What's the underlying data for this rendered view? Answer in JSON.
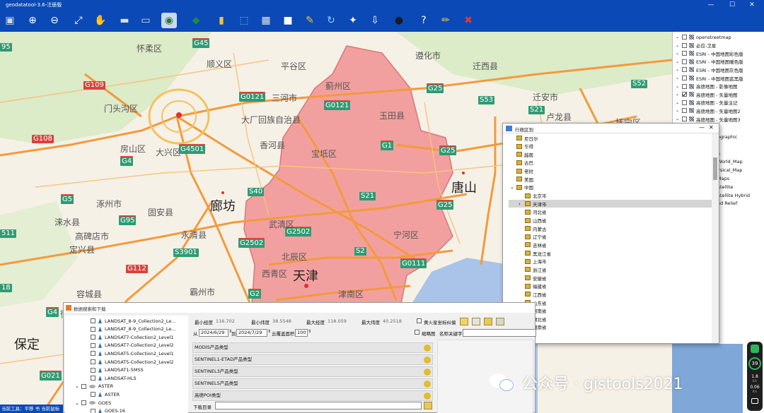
{
  "window": {
    "title": "geodatatool-3.6-注册版"
  },
  "toolbar": {
    "buttons": [
      {
        "name": "save-icon",
        "glyph": "▣",
        "color": "#cfd8ea"
      },
      {
        "name": "zoom-in-icon",
        "glyph": "⊕",
        "color": "#ffffff"
      },
      {
        "name": "zoom-out-icon",
        "glyph": "⊖",
        "color": "#ffffff"
      },
      {
        "name": "full-extent-icon",
        "glyph": "⤢",
        "color": "#ffffff"
      },
      {
        "name": "pan-hand-icon",
        "glyph": "✋",
        "color": "#ffffff"
      },
      {
        "name": "measure-icon",
        "glyph": "▬",
        "color": "#d9dde6"
      },
      {
        "name": "ruler-icon",
        "glyph": "▭",
        "color": "#d9dde6"
      },
      {
        "name": "identify-icon",
        "glyph": "◉",
        "color": "#2a7a2a"
      },
      {
        "name": "layer-icon",
        "glyph": "◆",
        "color": "#1c8b3d"
      },
      {
        "name": "attribute-icon",
        "glyph": "▮",
        "color": "#f0c33c"
      },
      {
        "name": "select-icon",
        "glyph": "⬚",
        "color": "#7ec0f0"
      },
      {
        "name": "grid-icon",
        "glyph": "▦",
        "color": "#e8e8e8"
      },
      {
        "name": "clear-icon",
        "glyph": "■",
        "color": "#ffffff"
      },
      {
        "name": "tools-icon",
        "glyph": "✎",
        "color": "#f0c33c"
      },
      {
        "name": "refresh-icon",
        "glyph": "↻",
        "color": "#8fd0ff"
      },
      {
        "name": "gps-icon",
        "glyph": "✦",
        "color": "#ffffff"
      },
      {
        "name": "download-icon",
        "glyph": "⇩",
        "color": "#ffffff"
      },
      {
        "name": "user-icon",
        "glyph": "●",
        "color": "#1b1b1b"
      },
      {
        "name": "help-icon",
        "glyph": "?",
        "color": "#ffffff"
      },
      {
        "name": "edit-icon",
        "glyph": "✏",
        "color": "#f0c33c"
      },
      {
        "name": "exit-icon",
        "glyph": "✖",
        "color": "#e23c2c"
      }
    ]
  },
  "map": {
    "roads": [
      {
        "label": "G45",
        "type": "g"
      },
      {
        "label": "G109",
        "type": "r"
      },
      {
        "label": "G0121",
        "type": "g"
      },
      {
        "label": "G0121",
        "type": "g"
      },
      {
        "label": "G25",
        "type": "g"
      },
      {
        "label": "S53",
        "type": "s"
      },
      {
        "label": "S52",
        "type": "s"
      },
      {
        "label": "S21",
        "type": "s"
      },
      {
        "label": "G108",
        "type": "r"
      },
      {
        "label": "G4501",
        "type": "g"
      },
      {
        "label": "G1",
        "type": "g"
      },
      {
        "label": "G25",
        "type": "g"
      },
      {
        "label": "G4",
        "type": "g"
      },
      {
        "label": "S40",
        "type": "s"
      },
      {
        "label": "S21",
        "type": "s"
      },
      {
        "label": "G5",
        "type": "g"
      },
      {
        "label": "G25",
        "type": "g"
      },
      {
        "label": "G95",
        "type": "g"
      },
      {
        "label": "G2502",
        "type": "g"
      },
      {
        "label": "G2502",
        "type": "g"
      },
      {
        "label": "S2",
        "type": "s"
      },
      {
        "label": "S3901",
        "type": "s"
      },
      {
        "label": "G0111",
        "type": "g"
      },
      {
        "label": "G112",
        "type": "r"
      },
      {
        "label": "G2",
        "type": "g"
      },
      {
        "label": "G4",
        "type": "g"
      },
      {
        "label": "G021",
        "type": "g"
      },
      {
        "label": "95",
        "type": "s"
      },
      {
        "label": "511",
        "type": "s"
      },
      {
        "label": "18",
        "type": "s"
      }
    ],
    "places": [
      "怀柔区",
      "顺义区",
      "平谷区",
      "遵化市",
      "迁西县",
      "蓟州区",
      "三河市",
      "门头沟区",
      "大厂回族自治县",
      "玉田县",
      "迁安市",
      "卢龙县",
      "丰润区",
      "房山区",
      "大兴区",
      "香河县",
      "宝坻区",
      "滦州市",
      "涿州市",
      "廊坊",
      "唐山",
      "涞水县",
      "固安县",
      "武清区",
      "宁河区",
      "高碑店市",
      "永清县",
      "定兴县",
      "北辰区",
      "天津",
      "西青区",
      "霸州市",
      "徐水区",
      "容城县",
      "津南区",
      "保定",
      "抚宁区"
    ],
    "cities": [
      "北京",
      "廊坊",
      "唐山",
      "天津",
      "保定"
    ]
  },
  "layers": {
    "items": [
      {
        "label": "openstreetmap",
        "checked": false
      },
      {
        "label": "必应-卫星",
        "checked": false
      },
      {
        "label": "ESRI - 中国地图彩色版",
        "checked": false
      },
      {
        "label": "ESRI - 中国地图暖色版",
        "checked": false
      },
      {
        "label": "ESRI - 中国地图灰色版",
        "checked": false
      },
      {
        "label": "ESRI - 中国地图蓝黑版",
        "checked": false
      },
      {
        "label": "高德地图 - 影像地图",
        "checked": false
      },
      {
        "label": "高德地图 - 矢量地图",
        "checked": true
      },
      {
        "label": "高德地图 - 矢量注记",
        "checked": false
      },
      {
        "label": "高德地图 - 矢量地图2",
        "checked": false
      },
      {
        "label": "高德地图 - 矢量地图3",
        "checked": false
      }
    ],
    "partial": [
      "ographic",
      "t",
      "e",
      "World_Map",
      "ysical_Map",
      "Maps",
      "atellite",
      "atellite Hybrid",
      "ed Relief"
    ]
  },
  "region_dialog": {
    "title": "行政区划",
    "items": [
      {
        "label": "尼日尔",
        "level": 1,
        "expander": ""
      },
      {
        "label": "乍得",
        "level": 1,
        "expander": ""
      },
      {
        "label": "越南",
        "level": 1,
        "expander": ""
      },
      {
        "label": "古巴",
        "level": 1,
        "expander": ""
      },
      {
        "label": "老挝",
        "level": 1,
        "expander": ""
      },
      {
        "label": "美国",
        "level": 1,
        "expander": ""
      },
      {
        "label": "中国",
        "level": 1,
        "expander": "⌄"
      },
      {
        "label": "北京市",
        "level": 2,
        "expander": ""
      },
      {
        "label": "天津市",
        "level": 2,
        "expander": "›",
        "selected": true
      },
      {
        "label": "河北省",
        "level": 2,
        "expander": ""
      },
      {
        "label": "山西省",
        "level": 2,
        "expander": ""
      },
      {
        "label": "内蒙古",
        "level": 2,
        "expander": ""
      },
      {
        "label": "辽宁省",
        "level": 2,
        "expander": ""
      },
      {
        "label": "吉林省",
        "level": 2,
        "expander": ""
      },
      {
        "label": "黑龙江省",
        "level": 2,
        "expander": ""
      },
      {
        "label": "上海市",
        "level": 2,
        "expander": ""
      },
      {
        "label": "浙江省",
        "level": 2,
        "expander": ""
      },
      {
        "label": "安徽省",
        "level": 2,
        "expander": ""
      },
      {
        "label": "福建省",
        "level": 2,
        "expander": ""
      },
      {
        "label": "江西省",
        "level": 2,
        "expander": ""
      },
      {
        "label": "山东省",
        "level": 2,
        "expander": ""
      },
      {
        "label": "河南省",
        "level": 2,
        "expander": ""
      },
      {
        "label": "湖北省",
        "level": 2,
        "expander": ""
      },
      {
        "label": "湖南省",
        "level": 2,
        "expander": ""
      }
    ]
  },
  "search_panel": {
    "title": "数据搜索和下载",
    "datasets": [
      {
        "label": "LANDSAT_8-9_Collection2_Le...",
        "kind": "item",
        "level": 2
      },
      {
        "label": "LANDSAT_8-9_Collection2_Le...",
        "kind": "item",
        "level": 2
      },
      {
        "label": "LANDSAT7-Collection2_Level1",
        "kind": "item",
        "level": 2
      },
      {
        "label": "LANDSAT7-Collection2_Level2",
        "kind": "item",
        "level": 2
      },
      {
        "label": "LANDSAT5-Collection2_Level1",
        "kind": "item",
        "level": 2
      },
      {
        "label": "LANDSAT5-Collection2_Level2",
        "kind": "item",
        "level": 2
      },
      {
        "label": "LANDSAT1-5MSS",
        "kind": "item",
        "level": 2
      },
      {
        "label": "LANDSAT-HLS",
        "kind": "item",
        "level": 2
      },
      {
        "label": "ASTER",
        "kind": "group",
        "level": 1
      },
      {
        "label": "ASTER",
        "kind": "item",
        "level": 2
      },
      {
        "label": "GOES",
        "kind": "group",
        "level": 1
      },
      {
        "label": "GOES-16",
        "kind": "item",
        "level": 2
      }
    ],
    "bounds": {
      "min_lon_label": "最小经度",
      "min_lon": "116.702",
      "min_lat_label": "最小纬度",
      "min_lat": "38.5548",
      "max_lon_label": "最大经度",
      "max_lon": "118.059",
      "max_lat_label": "最大纬度",
      "max_lat": "40.2518"
    },
    "fire_coord_label": "黄火星坐标纠偏",
    "date_from_label": "从",
    "date_from": "2024/6/29",
    "date_to_label": "到",
    "date_to": "2024/7/29",
    "cloud_label": "云覆盖面积",
    "cloud_value": "100",
    "thumbnail_label": "缩略图",
    "keyword_label": "名称关键字",
    "products": [
      "MODIS产品类型",
      "SENTINEL1-ETAD产品类型",
      "SENTINEL3产品类型",
      "SENTINEL5产品类型",
      "高德POI类型"
    ],
    "download_label": "下载目录"
  },
  "status": {
    "text": "当前工具：平移  书  当前鼠标"
  },
  "gauge": {
    "value": "39",
    "unit": "%",
    "up": "1.8",
    "down": "0.06",
    "rate_unit": "K/s"
  },
  "watermark": {
    "text": "公众号 · gistools2021"
  }
}
